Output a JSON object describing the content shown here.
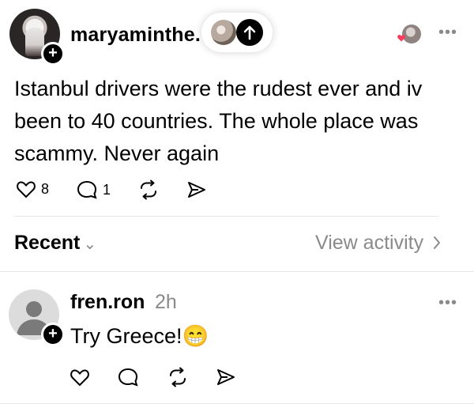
{
  "post": {
    "username": "maryaminthe.",
    "text": "Istanbul drivers were the rudest ever and iv been to 40 countries. The whole place was scammy. Never again",
    "likes": "8",
    "replies": "1",
    "icons": {
      "avatar": "user-avatar-photo",
      "follow": "plus-icon",
      "upload": "arrow-up-icon",
      "like": "heart-icon",
      "reply": "comment-icon",
      "repost": "repost-icon",
      "share": "send-icon",
      "more": "more-icon"
    }
  },
  "recent_bar": {
    "sort_label": "Recent",
    "view_activity": "View activity"
  },
  "reply": {
    "username": "fren.ron",
    "time": "2h",
    "text": "Try Greece!",
    "emoji": "😁"
  },
  "colors": {
    "text": "#000000",
    "muted": "#8a8a8a",
    "divider": "#e6e6e6",
    "heart_red": "#ff3b5c"
  }
}
